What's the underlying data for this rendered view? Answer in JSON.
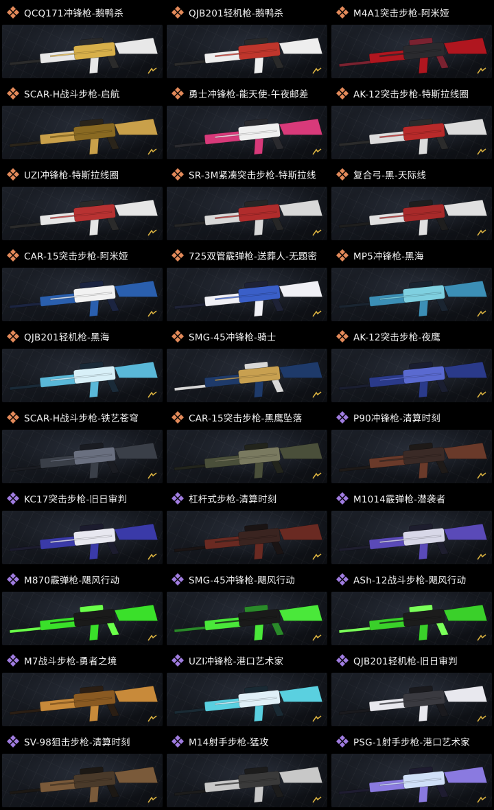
{
  "colors": {
    "legendary_orange": "#e38a5a",
    "epic_purple": "#a07ce0",
    "title_text": "#f2f2f2"
  },
  "icons": {
    "legendary": "orange-diamond-rarity-icon",
    "epic": "purple-diamond-rarity-icon"
  },
  "skins": [
    {
      "title": "QCQ171冲锋枪-鹅鸭杀",
      "rarity": "legendary",
      "palette": [
        "#e8e8e8",
        "#d8b04a",
        "#2b2b2b"
      ]
    },
    {
      "title": "QJB201轻机枪-鹅鸭杀",
      "rarity": "legendary",
      "palette": [
        "#eeeeee",
        "#c0362c",
        "#2a2a2a"
      ]
    },
    {
      "title": "M4A1突击步枪-阿米娅",
      "rarity": "legendary",
      "palette": [
        "#b0161f",
        "#2a2a2e",
        "#7a2230"
      ]
    },
    {
      "title": "SCAR-H战斗步枪-启航",
      "rarity": "legendary",
      "palette": [
        "#c9a04a",
        "#8a6a22",
        "#2a241a"
      ]
    },
    {
      "title": "勇士冲锋枪-能天使-午夜邮差",
      "rarity": "legendary",
      "palette": [
        "#d83a7a",
        "#f0f0f0",
        "#2a2a2e"
      ]
    },
    {
      "title": "AK-12突击步枪-特斯拉线圈",
      "rarity": "legendary",
      "palette": [
        "#dcdcdc",
        "#b82a2a",
        "#2b2b2b"
      ]
    },
    {
      "title": "UZI冲锋枪-特斯拉线圈",
      "rarity": "legendary",
      "palette": [
        "#e6e6e6",
        "#b83232",
        "#2a2a2a"
      ]
    },
    {
      "title": "SR-3M紧凑突击步枪-特斯拉线",
      "rarity": "legendary",
      "palette": [
        "#d8d8d8",
        "#b02c2c",
        "#262626"
      ]
    },
    {
      "title": "复合弓-黑-天际线",
      "rarity": "legendary",
      "palette": [
        "#e0e0e0",
        "#a82a2a",
        "#1e1e1e"
      ]
    },
    {
      "title": "CAR-15突击步枪-阿米娅",
      "rarity": "legendary",
      "palette": [
        "#2a5fae",
        "#f2f2f2",
        "#1b2440"
      ]
    },
    {
      "title": "725双管霰弹枪-送葬人-无题密",
      "rarity": "legendary",
      "palette": [
        "#f0f0f5",
        "#3a5fc8",
        "#1e2236"
      ]
    },
    {
      "title": "MP5冲锋枪-黑海",
      "rarity": "legendary",
      "palette": [
        "#3c8fb6",
        "#7fd0e0",
        "#1a2430"
      ]
    },
    {
      "title": "QJB201轻机枪-黑海",
      "rarity": "legendary",
      "palette": [
        "#5ab8d8",
        "#d8f0f8",
        "#1a2a38"
      ]
    },
    {
      "title": "SMG-45冲锋枪-骑士",
      "rarity": "legendary",
      "palette": [
        "#1e3a6a",
        "#c8a050",
        "#d8d8d8"
      ]
    },
    {
      "title": "AK-12突击步枪-夜鹰",
      "rarity": "legendary",
      "palette": [
        "#2a3a8a",
        "#5a6ad0",
        "#1a1e30"
      ]
    },
    {
      "title": "SCAR-H战斗步枪-铁艺苍穹",
      "rarity": "legendary",
      "palette": [
        "#3a3f48",
        "#6a7080",
        "#1a1c22"
      ]
    },
    {
      "title": "CAR-15突击步枪-黑鹰坠落",
      "rarity": "legendary",
      "palette": [
        "#4a4f3a",
        "#7a7a60",
        "#22241c"
      ]
    },
    {
      "title": "P90冲锋枪-清算时刻",
      "rarity": "epic",
      "palette": [
        "#6a3a2a",
        "#3a2a26",
        "#1e1a18"
      ]
    },
    {
      "title": "KC17突击步枪-旧日审判",
      "rarity": "epic",
      "palette": [
        "#3a3aa8",
        "#e8e8f0",
        "#1c1c2e"
      ]
    },
    {
      "title": "杠杆式步枪-清算时刻",
      "rarity": "epic",
      "palette": [
        "#6a2a22",
        "#3a2420",
        "#1a1414"
      ]
    },
    {
      "title": "M1014霰弹枪-潜袭者",
      "rarity": "epic",
      "palette": [
        "#5a4ab8",
        "#d8d8e8",
        "#1e1e2e"
      ]
    },
    {
      "title": "M870霰弹枪-飓风行动",
      "rarity": "epic",
      "palette": [
        "#3ae02a",
        "#1a1a1a",
        "#6aff4a"
      ]
    },
    {
      "title": "SMG-45冲锋枪-飓风行动",
      "rarity": "epic",
      "palette": [
        "#4ae83a",
        "#1a1a1a",
        "#2a8a2a"
      ]
    },
    {
      "title": "ASh-12战斗步枪-飓风行动",
      "rarity": "epic",
      "palette": [
        "#3ad02a",
        "#1c1c1c",
        "#7aff5a"
      ]
    },
    {
      "title": "M7战斗步枪-勇者之境",
      "rarity": "epic",
      "palette": [
        "#c88a3a",
        "#8a5a22",
        "#2a1e14"
      ]
    },
    {
      "title": "UZI冲锋枪-港口艺术家",
      "rarity": "epic",
      "palette": [
        "#5ad0e0",
        "#e0f0f8",
        "#1a2a34"
      ]
    },
    {
      "title": "QJB201轻机枪-旧日审判",
      "rarity": "epic",
      "palette": [
        "#e8e8ee",
        "#3a3a40",
        "#1a1a1e"
      ]
    },
    {
      "title": "SV-98狙击步枪-清算时刻",
      "rarity": "epic",
      "palette": [
        "#7a5a3a",
        "#4a3a2a",
        "#1c1814"
      ]
    },
    {
      "title": "M14射手步枪-猛攻",
      "rarity": "epic",
      "palette": [
        "#c8c8c8",
        "#3a3a3a",
        "#1c1c1c"
      ]
    },
    {
      "title": "PSG-1射手步枪-港口艺术家",
      "rarity": "epic",
      "palette": [
        "#8a7ae0",
        "#d0e0f8",
        "#1e1c30"
      ]
    }
  ]
}
